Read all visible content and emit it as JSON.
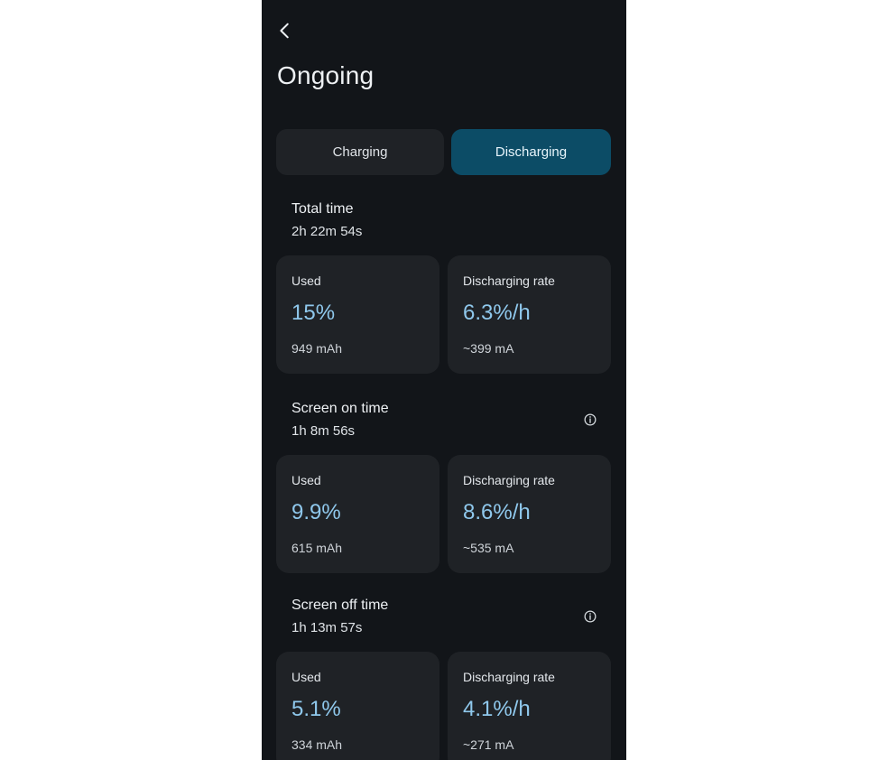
{
  "header": {
    "title": "Ongoing",
    "back_icon": "chevron-left-icon"
  },
  "tabs": [
    {
      "label": "Charging",
      "selected": false
    },
    {
      "label": "Discharging",
      "selected": true
    }
  ],
  "colors": {
    "background": "#121519",
    "card": "#1f2226",
    "accent_tab": "#0c4c66",
    "value_text": "#8fc8ec"
  },
  "sections": [
    {
      "title": "Total time",
      "value": "2h 22m 54s",
      "has_info": false,
      "used": {
        "label": "Used",
        "value": "15%",
        "sub": "949 mAh"
      },
      "rate": {
        "label": "Discharging rate",
        "value": "6.3%/h",
        "sub": "~399 mA"
      }
    },
    {
      "title": "Screen on time",
      "value": "1h 8m 56s",
      "has_info": true,
      "info_icon": "info-icon",
      "used": {
        "label": "Used",
        "value": "9.9%",
        "sub": "615 mAh"
      },
      "rate": {
        "label": "Discharging rate",
        "value": "8.6%/h",
        "sub": "~535 mA"
      }
    },
    {
      "title": "Screen off time",
      "value": "1h 13m 57s",
      "has_info": true,
      "info_icon": "info-icon",
      "used": {
        "label": "Used",
        "value": "5.1%",
        "sub": "334 mAh"
      },
      "rate": {
        "label": "Discharging rate",
        "value": "4.1%/h",
        "sub": "~271 mA"
      }
    }
  ]
}
